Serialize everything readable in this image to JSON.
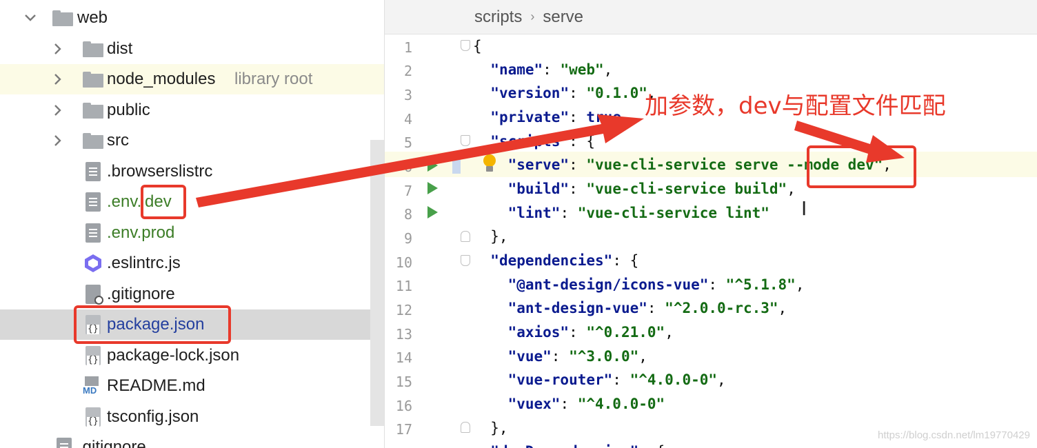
{
  "project_tree": {
    "root": {
      "name": "web"
    },
    "items": [
      {
        "name": "dist"
      },
      {
        "name": "node_modules",
        "hint": "library root"
      },
      {
        "name": "public"
      },
      {
        "name": "src"
      },
      {
        "name": ".browserslistrc"
      },
      {
        "name_prefix": ".env.",
        "name_suffix": "dev"
      },
      {
        "name": ".env.prod"
      },
      {
        "name": ".eslintrc.js"
      },
      {
        "name": ".gitignore"
      },
      {
        "name": "package.json"
      },
      {
        "name": "package-lock.json"
      },
      {
        "name": "README.md",
        "icon_text": "MD"
      },
      {
        "name": "tsconfig.json"
      },
      {
        "name": ".gitignore"
      }
    ]
  },
  "editor": {
    "breadcrumb": [
      "scripts",
      "serve"
    ],
    "line_numbers": [
      "1",
      "2",
      "3",
      "4",
      "5",
      "6",
      "7",
      "8",
      "9",
      "10",
      "11",
      "12",
      "13",
      "14",
      "15",
      "16",
      "17"
    ],
    "lines": {
      "l2": {
        "key": "\"name\"",
        "val": "\"web\""
      },
      "l3": {
        "key": "\"version\"",
        "val": "\"0.1.0\""
      },
      "l4": {
        "key": "\"private\"",
        "val": "true"
      },
      "l5": {
        "key": "\"scripts\""
      },
      "l6": {
        "key": "\"serve\"",
        "val": "\"vue-cli-service serve --mode dev\""
      },
      "l7": {
        "key": "\"build\"",
        "val": "\"vue-cli-service build\""
      },
      "l8": {
        "key": "\"lint\"",
        "val": "\"vue-cli-service lint\""
      },
      "l10": {
        "key": "\"dependencies\""
      },
      "l11": {
        "key": "\"@ant-design/icons-vue\"",
        "val": "\"^5.1.8\""
      },
      "l12": {
        "key": "\"ant-design-vue\"",
        "val": "\"^2.0.0-rc.3\""
      },
      "l13": {
        "key": "\"axios\"",
        "val": "\"^0.21.0\""
      },
      "l14": {
        "key": "\"vue\"",
        "val": "\"^3.0.0\""
      },
      "l15": {
        "key": "\"vue-router\"",
        "val": "\"^4.0.0-0\""
      },
      "l16": {
        "key": "\"vuex\"",
        "val": "\"^4.0.0-0\""
      },
      "l18": {
        "key": "\"devDependencies\""
      }
    }
  },
  "annotation": {
    "text": "加参数，dev与配置文件匹配",
    "color": "#e8392b"
  },
  "watermark": "https://blog.csdn.net/lm19770429"
}
